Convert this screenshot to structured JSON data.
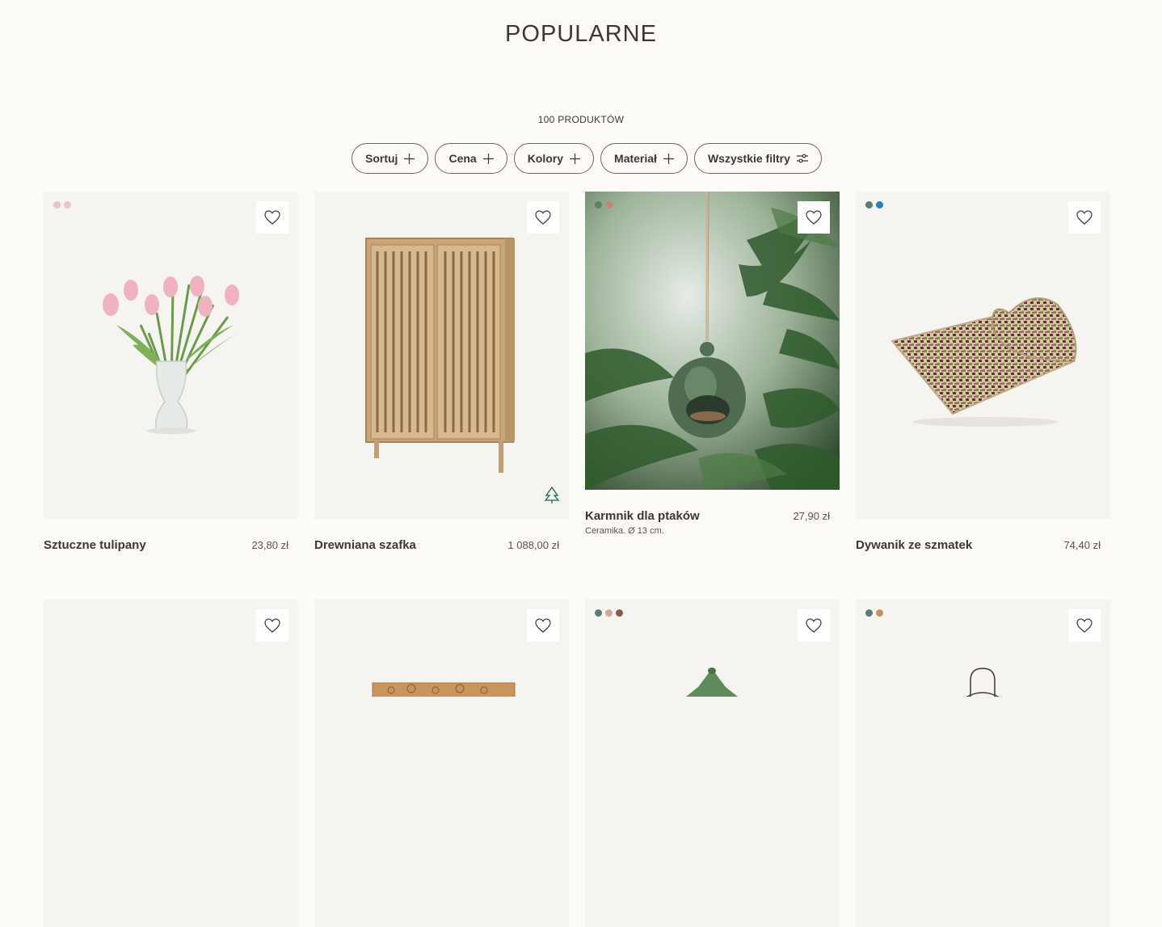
{
  "header": {
    "title": "POPULARNE"
  },
  "listing": {
    "count_label": "100 PRODUKTÓW"
  },
  "filters": [
    {
      "label": "Sortuj",
      "icon": "plus-icon"
    },
    {
      "label": "Cena",
      "icon": "plus-icon"
    },
    {
      "label": "Kolory",
      "icon": "plus-icon"
    },
    {
      "label": "Materiał",
      "icon": "plus-icon"
    },
    {
      "label": "Wszystkie filtry",
      "icon": "sliders-icon"
    }
  ],
  "products": [
    {
      "name": "Sztuczne tulipany",
      "price": "23,80 zł",
      "swatches": [
        "#e8c5cb",
        "#e8c5cb"
      ]
    },
    {
      "name": "Drewniana szafka",
      "price": "1 088,00 zł",
      "swatches": [],
      "badge": "FSC"
    },
    {
      "name": "Karmnik dla ptaków",
      "price": "27,90 zł",
      "subtitle": "Ceramika. Ø 13 cm.",
      "swatches": [
        "#5f7e63",
        "#c48a6a"
      ]
    },
    {
      "name": "Dywanik ze szmatek",
      "price": "74,40 zł",
      "swatches": [
        "#5d7a73",
        "#1e7fc9"
      ]
    },
    {
      "name": "",
      "price": "",
      "swatches": []
    },
    {
      "name": "",
      "price": "",
      "swatches": []
    },
    {
      "name": "",
      "price": "",
      "swatches": [
        "#5b7a76",
        "#d6a49a",
        "#8a5a48"
      ]
    },
    {
      "name": "",
      "price": "",
      "swatches": [
        "#5b7a76",
        "#c49060"
      ]
    }
  ],
  "colors": {
    "background": "#fcfbf7",
    "text": "#3d3833",
    "card_bg": "#f5f4f1"
  }
}
